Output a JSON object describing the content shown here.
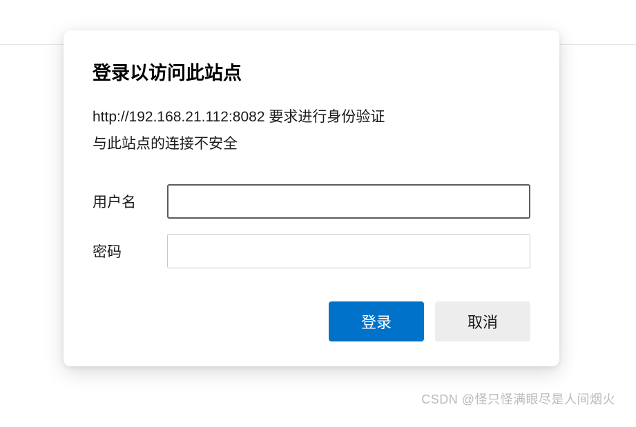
{
  "dialog": {
    "title": "登录以访问此站点",
    "message_line1": "http://192.168.21.112:8082 要求进行身份验证",
    "message_line2": "与此站点的连接不安全",
    "username_label": "用户名",
    "password_label": "密码",
    "username_value": "",
    "password_value": "",
    "login_button": "登录",
    "cancel_button": "取消"
  },
  "watermark": "CSDN @怪只怪满眼尽是人间烟火"
}
